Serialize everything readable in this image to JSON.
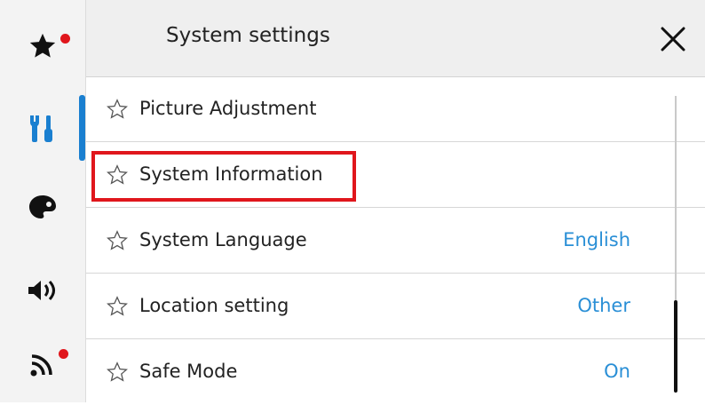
{
  "header": {
    "title": "System settings",
    "close_icon": "close-icon"
  },
  "sidebar": {
    "items": [
      {
        "icon": "favorites-star-icon",
        "badge": true
      },
      {
        "icon": "tools-icon",
        "active": true
      },
      {
        "icon": "palette-icon"
      },
      {
        "icon": "speaker-volume-icon"
      },
      {
        "icon": "wireless-network-icon",
        "badge": true
      }
    ]
  },
  "list": {
    "rows": [
      {
        "label": "Picture Adjustment",
        "value": ""
      },
      {
        "label": "System Information",
        "value": "",
        "highlighted": true
      },
      {
        "label": "System Language",
        "value": "English"
      },
      {
        "label": "Location setting",
        "value": "Other"
      },
      {
        "label": "Safe Mode",
        "value": "On"
      }
    ]
  },
  "colors": {
    "accent": "#1a7fd0",
    "value_text": "#2a8fd6",
    "badge": "#e0161c",
    "highlight_border": "#e0161c",
    "sidebar_bg": "#f3f3f3",
    "header_bg": "#efefef"
  }
}
